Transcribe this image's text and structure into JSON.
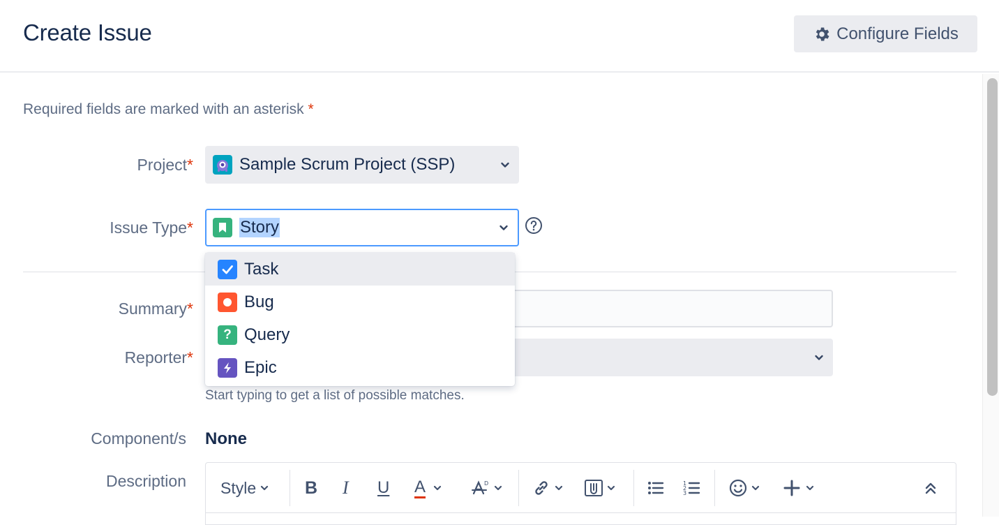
{
  "header": {
    "title": "Create Issue",
    "configure_label": "Configure Fields"
  },
  "form": {
    "required_note": "Required fields are marked with an asterisk",
    "asterisk": "*",
    "project": {
      "label": "Project",
      "value": "Sample Scrum Project (SSP)"
    },
    "issue_type": {
      "label": "Issue Type",
      "value": "Story",
      "options": [
        {
          "label": "Task",
          "icon": "task-icon"
        },
        {
          "label": "Bug",
          "icon": "bug-icon"
        },
        {
          "label": "Query",
          "icon": "query-icon",
          "glyph": "?"
        },
        {
          "label": "Epic",
          "icon": "epic-icon"
        }
      ],
      "highlighted_option": "Task"
    },
    "summary": {
      "label": "Summary",
      "value": ""
    },
    "reporter": {
      "label": "Reporter",
      "hint": "Start typing to get a list of possible matches."
    },
    "components": {
      "label": "Component/s",
      "value": "None"
    },
    "description": {
      "label": "Description",
      "toolbar": {
        "style_label": "Style",
        "bold": "B",
        "italic": "I",
        "underline": "U",
        "text_color": "A"
      }
    }
  },
  "colors": {
    "accent": "#4c9aff",
    "required": "#de350b",
    "story": "#36b37e",
    "task": "#2684ff",
    "bug": "#ff5630",
    "epic": "#6554c0",
    "text_color_underline": "#de350b"
  }
}
